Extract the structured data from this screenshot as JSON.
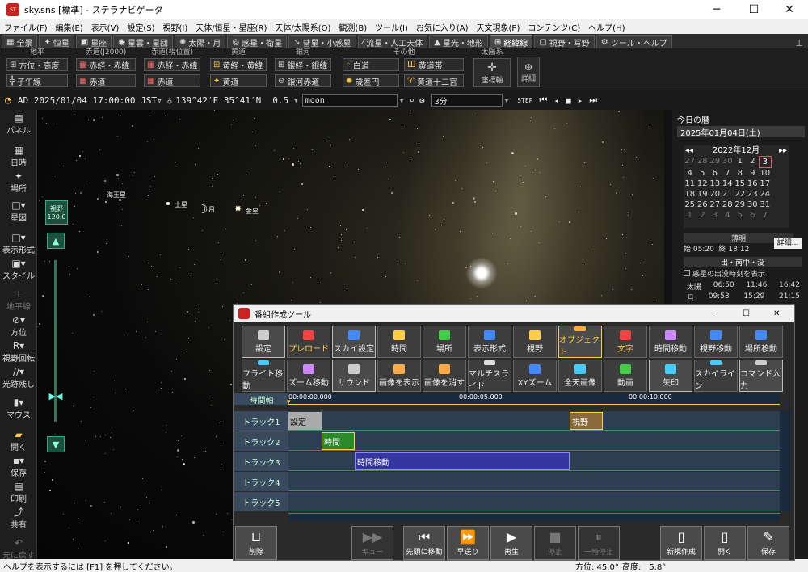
{
  "window": {
    "title": "sky.sns [標準] - ステラナビゲータ",
    "app_icon": "ST",
    "min": "─",
    "max": "☐",
    "close": "✕"
  },
  "menu": [
    "ファイル(F)",
    "編集(E)",
    "表示(V)",
    "設定(S)",
    "視野(I)",
    "天体/恒星・星座(R)",
    "天体/太陽系(O)",
    "観測(B)",
    "ツール(I)",
    "お気に入り(A)",
    "天文現象(P)",
    "コンテンツ(C)",
    "ヘルプ(H)"
  ],
  "tabs": [
    "全景",
    "恒星",
    "星座",
    "星雲・星団",
    "太陽・月",
    "惑星・衛星",
    "彗星・小惑星",
    "流星・人工天体",
    "星光・地形",
    "経緯線",
    "視野・写野",
    "ツール・ヘルプ"
  ],
  "ribbon": {
    "g1": {
      "title": "地平",
      "b1": "方位・高度",
      "b2": "子午線"
    },
    "g2": {
      "title": "赤道(J2000)",
      "b1": "赤経・赤緯",
      "b2": "赤道"
    },
    "g3": {
      "title": "赤道(視位置)",
      "b1": "赤経・赤緯",
      "b2": "赤道"
    },
    "g4": {
      "title": "黄道",
      "b1": "黄経・黄緯",
      "b2": "黄道"
    },
    "g5": {
      "title": "銀河",
      "b1": "銀経・銀緯",
      "b2": "銀河赤道"
    },
    "g6": {
      "title": "その他",
      "b1": "白道",
      "b2": "歳差円",
      "b3": "黄道帯",
      "b4": "黄道十二宮"
    },
    "g7": {
      "title": "太陽系",
      "b1": "座標軸"
    },
    "detail": "詳細"
  },
  "infobar": {
    "datetime": "AD 2025/01/04 17:00:00 JST▿",
    "coords": "139°42′E 35°41′N",
    "zoom": "0.5",
    "search": "moon",
    "step": "3分"
  },
  "left_panel": [
    "パネル",
    "日時",
    "場所",
    "星図",
    "表示形式",
    "スタイル",
    "地平線",
    "方位",
    "視野回転",
    "光跡残し",
    "マウス",
    "開く",
    "保存",
    "印刷",
    "共有",
    "元に戻す"
  ],
  "sky": {
    "fov_label": "視野",
    "fov_value": "120.0",
    "neptune": "海王星",
    "saturn": "土星",
    "moon": "月",
    "venus": "金星"
  },
  "right_panel": {
    "header": "今日の暦",
    "date": "2025年01月04日(土)",
    "cal_title": "2022年12月",
    "cal_rows": [
      [
        "27",
        "28",
        "29",
        "30",
        "1",
        "2",
        "3"
      ],
      [
        "4",
        "5",
        "6",
        "7",
        "8",
        "9",
        "10"
      ],
      [
        "11",
        "12",
        "13",
        "14",
        "15",
        "16",
        "17"
      ],
      [
        "18",
        "19",
        "20",
        "21",
        "22",
        "23",
        "24"
      ],
      [
        "25",
        "26",
        "27",
        "28",
        "29",
        "30",
        "31"
      ],
      [
        "1",
        "2",
        "3",
        "4",
        "5",
        "6",
        "7"
      ]
    ],
    "twilight": "薄明",
    "tw_start": "始 05:20",
    "tw_end": "終 18:12",
    "detail_btn": "詳細...",
    "rise_header": "出・南中・没",
    "checkbox": "惑星の出没時刻を表示",
    "sun": [
      "太陽",
      "06:50",
      "11:46",
      "16:42"
    ],
    "moon": [
      "月",
      "09:53",
      "15:29",
      "21:15"
    ]
  },
  "status": {
    "help": "ヘルプを表示するには [F1] を押してください。",
    "azimuth": "方位: 45.0°",
    "altitude": "高度:　5.8°"
  },
  "dialog": {
    "title": "番組作成ツール",
    "row1": [
      "設定",
      "プレロード",
      "スカイ設定",
      "時間",
      "場所",
      "表示形式",
      "視野",
      "オブジェクト",
      "文字",
      "時間移動",
      "視野移動",
      "場所移動"
    ],
    "row2": [
      "フライト移動",
      "ズーム移動",
      "サウンド",
      "画像を表示",
      "画像を消す",
      "マルチスライド",
      "XYズーム",
      "全天画像",
      "動画",
      "矢印",
      "スカイライン",
      "コマンド入力"
    ],
    "axis": "時間軸",
    "t0": "00:00:00.000",
    "t5": "00:00:05.000",
    "t10": "00:00:10.000",
    "tracks": [
      "トラック1",
      "トラック2",
      "トラック3",
      "トラック4",
      "トラック5"
    ],
    "clips": {
      "c1": "設定",
      "c2": "視野",
      "c3": "時間",
      "c4": "時間移動"
    },
    "buttons": [
      "削除",
      "キュー",
      "先頭に移動",
      "早送り",
      "再生",
      "停止",
      "一時停止",
      "新規作成",
      "開く",
      "保存"
    ]
  }
}
